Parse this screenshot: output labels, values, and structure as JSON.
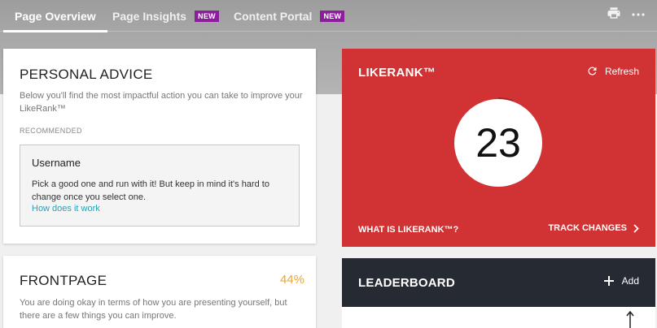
{
  "tabs": [
    {
      "label": "Page Overview",
      "badge": ""
    },
    {
      "label": "Page Insights",
      "badge": "NEW"
    },
    {
      "label": "Content Portal",
      "badge": "NEW"
    }
  ],
  "toolbar_icons": [
    "print-icon",
    "more-icon"
  ],
  "personal_advice": {
    "title": "PERSONAL ADVICE",
    "description": "Below you'll find the most impactful action you can take to improve your LikeRank™",
    "recommended_label": "RECOMMENDED",
    "recommendation": {
      "title": "Username",
      "text": "Pick a good one and run with it! But keep in mind it's hard to change once you select one.",
      "link": "How does it work"
    }
  },
  "frontpage": {
    "title": "FRONTPAGE",
    "percent": "44%",
    "description": "You are doing okay in terms of how you are presenting yourself, but there are a few things you can improve."
  },
  "likerank": {
    "title": "LIKERANK™",
    "refresh_label": "Refresh",
    "score": "23",
    "what_label": "WHAT IS LIKERANK™?",
    "track_label": "TRACK CHANGES"
  },
  "leaderboard": {
    "title": "LEADERBOARD",
    "add_label": "Add"
  },
  "colors": {
    "likerank_bg": "#d13233",
    "leaderboard_bg": "#262a33",
    "badge": "#8e1d9e",
    "link": "#2aa1b3",
    "percent": "#f0a52a"
  }
}
